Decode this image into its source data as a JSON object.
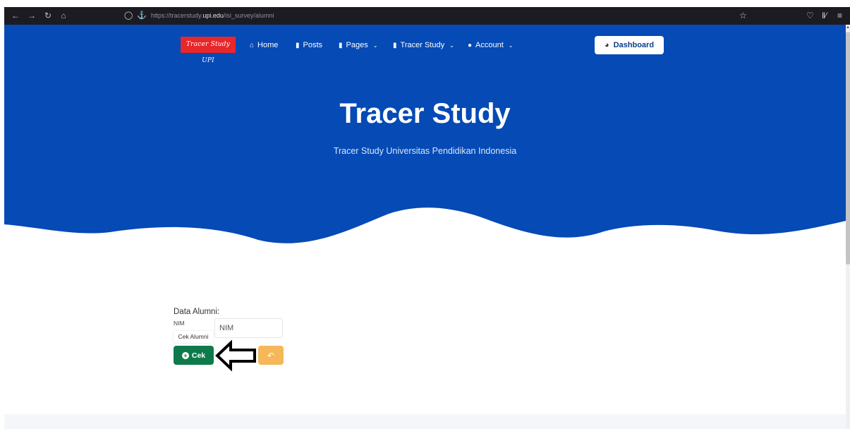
{
  "browser": {
    "url_prefix": "https://tracerstudy.",
    "url_domain": "upi.edu",
    "url_path": "/isi_survey/alumni",
    "icons": [
      "back-arrow-icon",
      "forward-arrow-icon",
      "reload-icon",
      "home-icon",
      "shield-icon",
      "lock-icon",
      "star-icon",
      "pocket-icon",
      "library-icon",
      "menu-icon"
    ]
  },
  "navbar": {
    "logo_text": "Tracer Study UPI",
    "items": [
      {
        "label": "Home",
        "icon": "home-icon",
        "dropdown": false
      },
      {
        "label": "Posts",
        "icon": "file-icon",
        "dropdown": false
      },
      {
        "label": "Pages",
        "icon": "file-icon",
        "dropdown": true
      },
      {
        "label": "Tracer Study",
        "icon": "file-icon",
        "dropdown": true
      },
      {
        "label": "Account",
        "icon": "user-icon",
        "dropdown": true
      }
    ],
    "dashboard_label": "Dashboard"
  },
  "hero": {
    "title": "Tracer Study",
    "subtitle": "Tracer Study Universitas Pendidikan Indonesia"
  },
  "form": {
    "section_label": "Data Alumni:",
    "nim_label": "NIM",
    "tooltip_label": "Cek Alumni",
    "nim_placeholder": "NIM",
    "check_button_label": "Cek"
  },
  "colors": {
    "chrome_bg": "#1c1b22",
    "hero_bg": "#054ab5",
    "logo_bg": "#e8272b",
    "check_button": "#0e7a4b",
    "back_button": "#f5b75a"
  }
}
